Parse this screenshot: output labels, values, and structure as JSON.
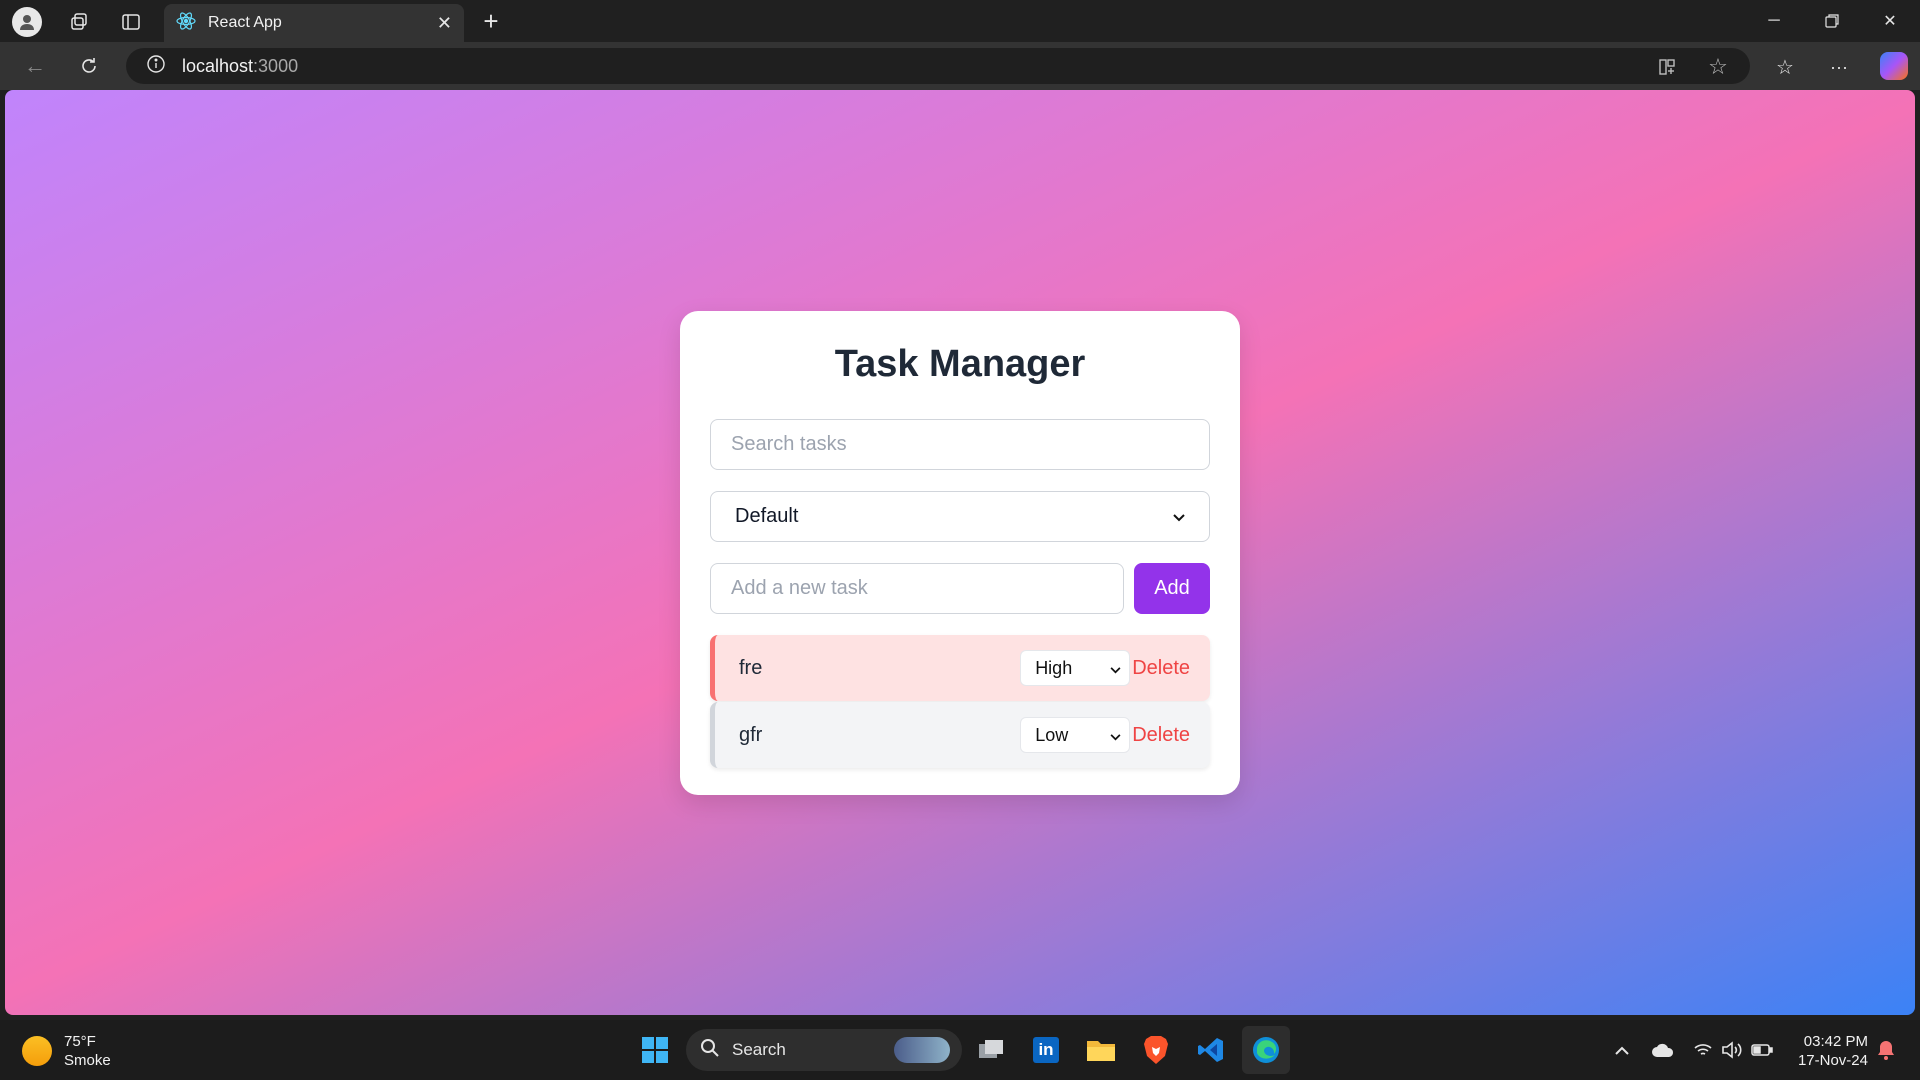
{
  "browser": {
    "tab_title": "React App",
    "address_host": "localhost",
    "address_port": ":3000"
  },
  "app": {
    "title": "Task Manager",
    "search_placeholder": "Search tasks",
    "sort_selected": "Default",
    "new_task_placeholder": "Add a new task",
    "add_label": "Add",
    "tasks": [
      {
        "text": "fre",
        "priority": "High",
        "delete_label": "Delete"
      },
      {
        "text": "gfr",
        "priority": "Low",
        "delete_label": "Delete"
      }
    ]
  },
  "taskbar": {
    "weather_temp": "75°F",
    "weather_desc": "Smoke",
    "search_label": "Search",
    "time": "03:42 PM",
    "date": "17-Nov-24"
  },
  "colors": {
    "gradient": [
      "#c084fc",
      "#f472b6",
      "#3b82f6"
    ],
    "accent": "#9333ea",
    "delete": "#ef4444",
    "high_bg": "#fee2e2",
    "low_bg": "#f3f4f6"
  }
}
